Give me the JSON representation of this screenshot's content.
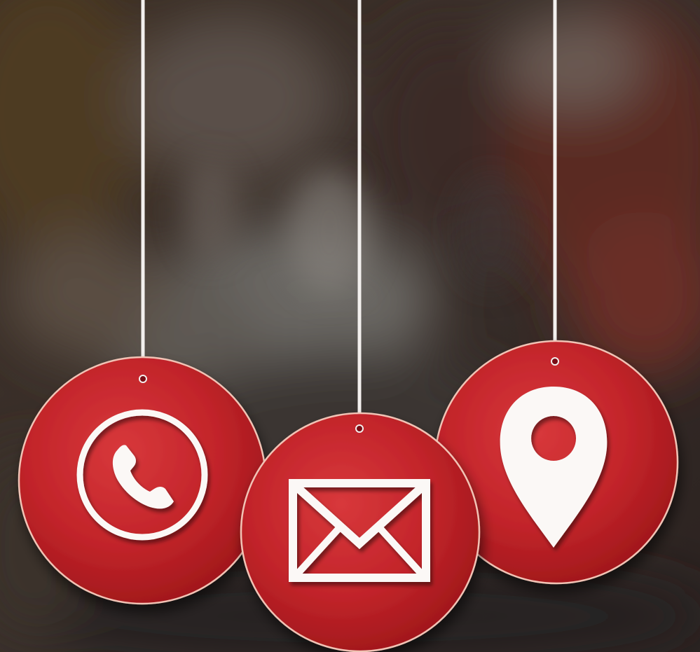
{
  "colors": {
    "tag_red": "#c8262a",
    "tag_red_dark": "#8f1215",
    "tag_rim": "#f1c3b5",
    "icon_white": "#fbf8f6",
    "string_white": "#f3f0ee"
  },
  "tags": [
    {
      "name": "phone-tag",
      "icon": "phone-icon"
    },
    {
      "name": "mail-tag",
      "icon": "envelope-icon"
    },
    {
      "name": "location-tag",
      "icon": "map-pin-icon"
    }
  ]
}
